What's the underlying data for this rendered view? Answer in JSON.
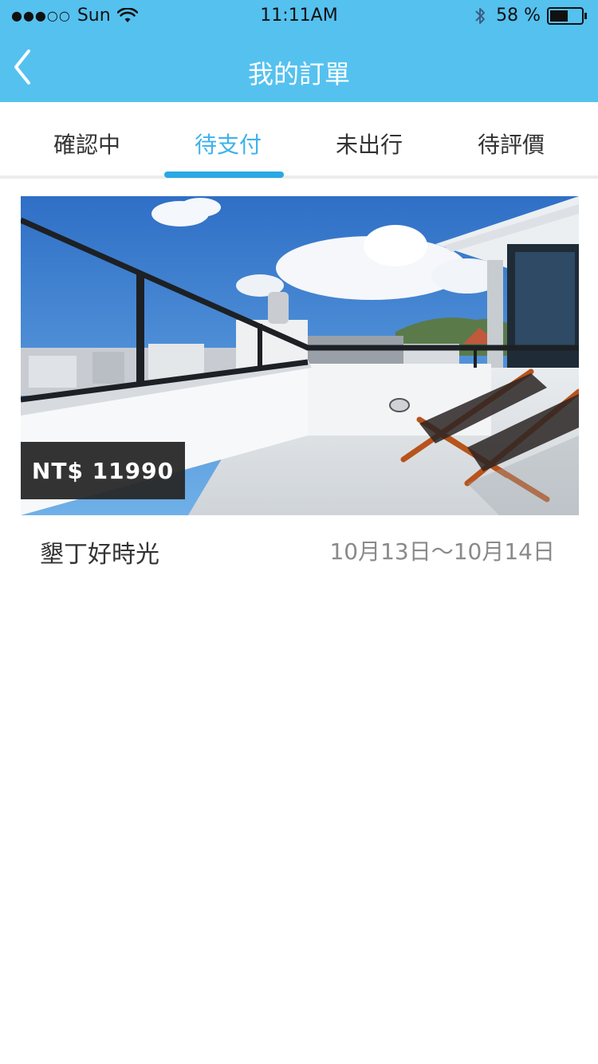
{
  "status_bar": {
    "signal": "●●●○○",
    "carrier": "Sun",
    "time": "11:11AM",
    "battery": "58 %"
  },
  "nav": {
    "title": "我的訂單"
  },
  "tabs": [
    {
      "label": "確認中",
      "active": false
    },
    {
      "label": "待支付",
      "active": true
    },
    {
      "label": "未出行",
      "active": false
    },
    {
      "label": "待評價",
      "active": false
    }
  ],
  "orders": [
    {
      "price": "NT$ 11990",
      "name": "墾丁好時光",
      "dates": "10月13日～10月14日"
    }
  ],
  "colors": {
    "header_bg": "#55c1ef",
    "tab_active": "#3fb2ec",
    "indicator": "#2aa8e6",
    "price_badge_bg": "#282828"
  }
}
